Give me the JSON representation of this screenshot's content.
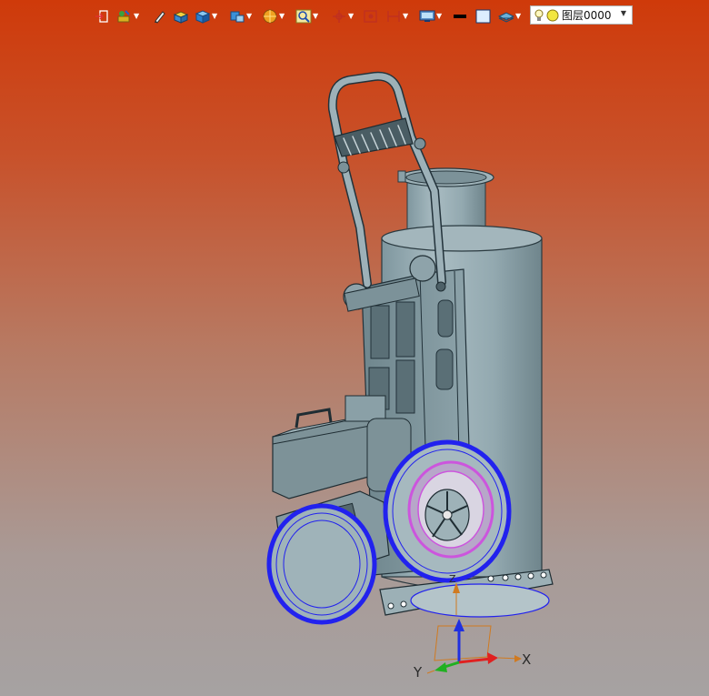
{
  "toolbar": {
    "layer_selector": {
      "value": "图层0000"
    },
    "buttons": [
      {
        "icon": "exit-sketch-icon",
        "has_dropdown": false
      },
      {
        "icon": "feature-wizard-icon",
        "has_dropdown": true
      },
      {
        "icon": "pencil-icon",
        "has_dropdown": false
      },
      {
        "icon": "solid-box-icon",
        "has_dropdown": false
      },
      {
        "icon": "cube-view-icon",
        "has_dropdown": true
      },
      {
        "icon": "display-style-icon",
        "has_dropdown": true
      },
      {
        "icon": "render-mode-icon",
        "has_dropdown": true
      },
      {
        "icon": "zoom-icon",
        "has_dropdown": true
      },
      {
        "icon": "pan-icon",
        "has_dropdown": true
      },
      {
        "icon": "section-view-icon",
        "has_dropdown": false
      },
      {
        "icon": "measure-icon",
        "has_dropdown": true
      },
      {
        "icon": "monitor-icon",
        "has_dropdown": true
      },
      {
        "icon": "line-color-icon",
        "has_dropdown": false
      },
      {
        "icon": "fill-color-icon",
        "has_dropdown": false
      },
      {
        "icon": "layer-icon",
        "has_dropdown": true
      }
    ]
  },
  "viewport": {
    "background_top": "#cf3a0a",
    "background_bottom": "#a6a2a2",
    "model_color": "#8fa6ae",
    "selection_color": "#2222ee",
    "highlight_color": "#cc55dd",
    "triad": {
      "x_label": "X",
      "y_label": "Y",
      "z_label": "Z",
      "x_color": "#e02020",
      "y_color": "#20b020",
      "z_color": "#2030e0"
    }
  }
}
